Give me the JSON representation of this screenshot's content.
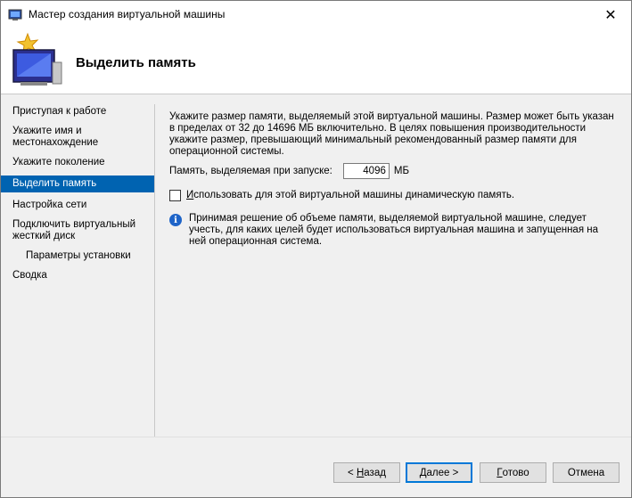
{
  "window": {
    "title": "Мастер создания виртуальной машины",
    "close_glyph": "✕"
  },
  "header": {
    "title": "Выделить память"
  },
  "nav": {
    "items": [
      {
        "label": "Приступая к работе"
      },
      {
        "label": "Укажите имя и местонахождение"
      },
      {
        "label": "Укажите поколение"
      },
      {
        "label": "Выделить память",
        "active": true
      },
      {
        "label": "Настройка сети"
      },
      {
        "label": "Подключить виртуальный жесткий диск"
      },
      {
        "label": "Параметры установки",
        "sub": true
      },
      {
        "label": "Сводка"
      }
    ]
  },
  "content": {
    "description": "Укажите размер памяти, выделяемый этой виртуальной машины. Размер может быть указан в пределах от 32 до 14696 МБ включительно. В целях повышения производительности укажите размер, превышающий минимальный рекомендованный размер памяти для операционной системы.",
    "memory_label": "Память, выделяемая при запуске:",
    "memory_value": "4096",
    "memory_unit": "МБ",
    "dynamic_memory_prefix": "И",
    "dynamic_memory_rest": "спользовать для этой виртуальной машины динамическую память.",
    "dynamic_memory_checked": false,
    "info_text": "Принимая решение об объеме памяти, выделяемой виртуальной машине, следует учесть, для каких целей будет использоваться виртуальная машина и запущенная на ней операционная система."
  },
  "buttons": {
    "back_prefix": "< ",
    "back_key": "Н",
    "back_rest": "азад",
    "next_key": "Д",
    "next_rest": "алее >",
    "finish_key": "Г",
    "finish_rest": "отово",
    "cancel": "Отмена"
  },
  "colors": {
    "accent": "#0063b1",
    "info": "#1e64c8"
  }
}
